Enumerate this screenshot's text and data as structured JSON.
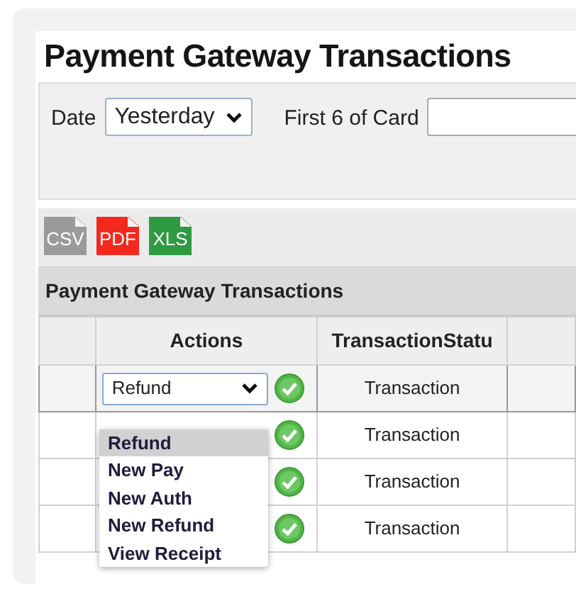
{
  "title": "Payment Gateway Transactions",
  "filters": {
    "date_label": "Date",
    "date_value": "Yesterday",
    "card_label": "First 6 of Card"
  },
  "exports": [
    {
      "label": "CSV",
      "color": "#9a9a9a"
    },
    {
      "label": "PDF",
      "color": "#f4281c"
    },
    {
      "label": "XLS",
      "color": "#2f9a42"
    }
  ],
  "grid": {
    "caption": "Payment Gateway Transactions",
    "columns": [
      "",
      "Actions",
      "TransactionStatu"
    ],
    "rows": [
      {
        "selected": true,
        "action": "Refund",
        "status": "Transaction"
      },
      {
        "selected": false,
        "status": "Transaction"
      },
      {
        "selected": false,
        "status": "Transaction"
      },
      {
        "selected": false,
        "status": "Transaction"
      }
    ]
  },
  "action_menu": {
    "options": [
      {
        "label": "Refund",
        "selected": true
      },
      {
        "label": "New Pay",
        "selected": false
      },
      {
        "label": "New Auth",
        "selected": false
      },
      {
        "label": "New Refund",
        "selected": false
      },
      {
        "label": "View Receipt",
        "selected": false
      }
    ]
  }
}
